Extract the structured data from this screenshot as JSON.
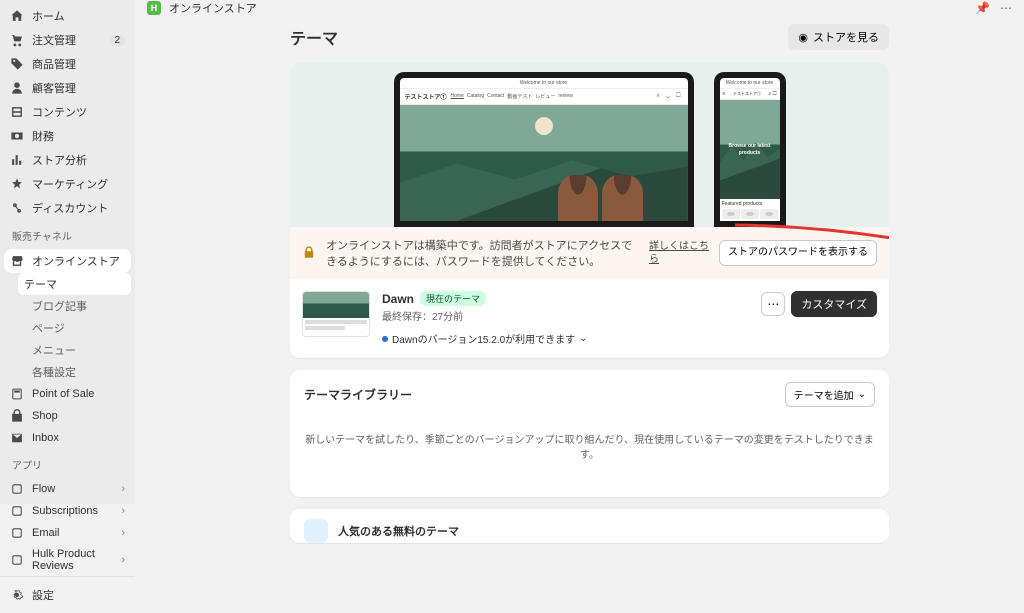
{
  "topbar": {
    "store_name": "オンラインストア"
  },
  "sidebar": {
    "main": [
      {
        "label": "ホーム",
        "icon": "home"
      },
      {
        "label": "注文管理",
        "icon": "orders",
        "badge": "2"
      },
      {
        "label": "商品管理",
        "icon": "products"
      },
      {
        "label": "顧客管理",
        "icon": "customers"
      },
      {
        "label": "コンテンツ",
        "icon": "content"
      },
      {
        "label": "財務",
        "icon": "finance"
      },
      {
        "label": "ストア分析",
        "icon": "analytics"
      },
      {
        "label": "マーケティング",
        "icon": "marketing"
      },
      {
        "label": "ディスカウント",
        "icon": "discounts"
      }
    ],
    "channels_label": "販売チャネル",
    "channels": [
      {
        "label": "オンラインストア",
        "icon": "store",
        "active": true,
        "sub": [
          {
            "label": "テーマ",
            "selected": true
          },
          {
            "label": "ブログ記事"
          },
          {
            "label": "ページ"
          },
          {
            "label": "メニュー"
          },
          {
            "label": "各種設定"
          }
        ]
      },
      {
        "label": "Point of Sale",
        "icon": "pos"
      },
      {
        "label": "Shop",
        "icon": "shop"
      },
      {
        "label": "Inbox",
        "icon": "inbox"
      }
    ],
    "apps_label": "アプリ",
    "apps": [
      {
        "label": "Flow"
      },
      {
        "label": "Subscriptions"
      },
      {
        "label": "Email"
      },
      {
        "label": "Hulk Product Reviews"
      }
    ],
    "settings": "設定"
  },
  "page": {
    "title": "テーマ",
    "view_store": "ストアを見る"
  },
  "preview": {
    "welcome": "Welcome to our store",
    "brand": "テストストア①",
    "nav": [
      "Home",
      "Catalog",
      "Contact",
      "動画テスト",
      "レビュー",
      "review"
    ],
    "mobile_hero": "Browse our latest products",
    "featured": "Featured products"
  },
  "banner": {
    "text": "オンラインストアは構築中です。訪問者がストアにアクセスできるようにするには、パスワードを提供してください。",
    "link": "詳しくはこちら",
    "button": "ストアのパスワードを表示する"
  },
  "theme": {
    "name": "Dawn",
    "badge": "現在のテーマ",
    "saved_label": "最終保存：",
    "saved_value": "27分前",
    "version": "Dawnのバージョン15.2.0が利用できます",
    "customize": "カスタマイズ"
  },
  "library": {
    "title": "テーマライブラリー",
    "add": "テーマを追加",
    "desc": "新しいテーマを試したり、季節ごとのバージョンアップに取り組んだり、現在使用しているテーマの変更をテストしたりできます。"
  },
  "popular": {
    "title": "人気のある無料のテーマ"
  }
}
